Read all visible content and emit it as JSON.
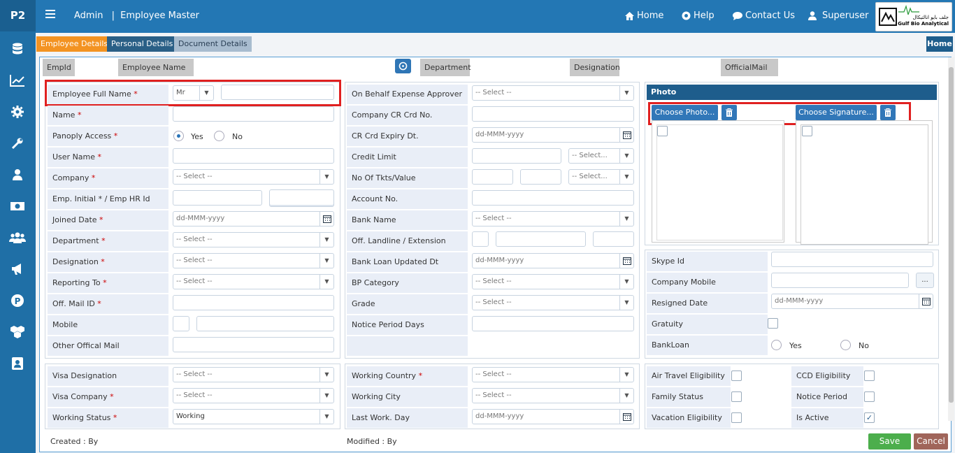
{
  "app": {
    "logo": "P2",
    "breadcrumb_root": "Admin",
    "breadcrumb_sep": "|",
    "breadcrumb_page": "Employee Master"
  },
  "topnav": {
    "home": "Home",
    "help": "Help",
    "contact": "Contact Us",
    "user": "Superuser",
    "brand_ar": "جلف بايو انالتيكال",
    "brand_en": "Gulf Bio Analytical"
  },
  "sidebar_icons": [
    "database-icon",
    "chart-icon",
    "gear-icon",
    "wrench-icon",
    "user-icon",
    "money-icon",
    "users-icon",
    "megaphone-icon",
    "parking-icon",
    "cubes-icon",
    "contact-card-icon"
  ],
  "tabs": {
    "employee_details": "Employee Details",
    "personal_details": "Personal Details",
    "document_details": "Document Details",
    "home": "Home"
  },
  "header": {
    "empid": "EmpId",
    "empname": "Employee Name",
    "department": "Department",
    "designation": "Designation",
    "officialmail": "OfficialMail"
  },
  "left": {
    "full_name": "Employee Full Name",
    "title_value": "Mr",
    "name": "Name",
    "panoply": "Panoply Access",
    "yes": "Yes",
    "no": "No",
    "username": "User Name",
    "company": "Company",
    "emp_initial": "Emp. Initial * / Emp HR Id",
    "joined": "Joined Date",
    "department": "Department",
    "designation": "Designation",
    "reporting": "Reporting To",
    "offmail": "Off. Mail ID",
    "mobile": "Mobile",
    "other_mail": "Other Offical Mail",
    "select_ph": "-- Select --",
    "date_ph": "dd-MMM-yyyy"
  },
  "middle": {
    "behalf": "On Behalf Expense Approver",
    "crcard": "Company CR Crd No.",
    "crexpiry": "CR Crd Expiry Dt.",
    "credit": "Credit Limit",
    "tkts": "No Of Tkts/Value",
    "account": "Account No.",
    "bank": "Bank Name",
    "landline": "Off. Landline / Extension",
    "bankloan": "Bank Loan Updated Dt",
    "bp": "BP Category",
    "grade": "Grade",
    "notice": "Notice Period Days",
    "select_short": "-- Select..."
  },
  "right": {
    "photo": "Photo",
    "choose_photo": "Choose Photo...",
    "choose_sig": "Choose Signature...",
    "skype": "Skype Id",
    "mobile": "Company Mobile",
    "more": "...",
    "resigned": "Resigned Date",
    "gratuity": "Gratuity",
    "bankloan": "BankLoan",
    "yes": "Yes",
    "no": "No"
  },
  "bottom": {
    "visa_desig": "Visa Designation",
    "visa_company": "Visa Company",
    "working_status": "Working Status",
    "working_status_val": "Working",
    "working_country": "Working Country",
    "working_city": "Working City",
    "last_day": "Last Work. Day",
    "air": "Air Travel Eligibility",
    "ccd": "CCD Eligibility",
    "family": "Family Status",
    "notice_period": "Notice Period",
    "vacation": "Vacation Eligibility",
    "active": "Is Active"
  },
  "footer": {
    "created": "Created : By",
    "modified": "Modified : By",
    "save": "Save",
    "cancel": "Cancel"
  },
  "colors": {
    "sidebar": "#1f6fa6",
    "topbar": "#2377b4",
    "active_tab": "#f39322",
    "red_highlight": "#e02020"
  }
}
